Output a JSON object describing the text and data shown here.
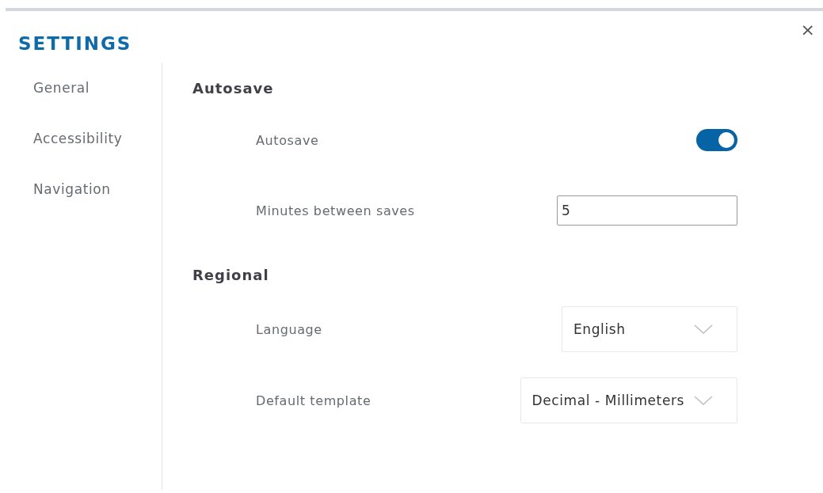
{
  "dialog": {
    "title": "SETTINGS",
    "close": "×"
  },
  "sidebar": {
    "items": [
      {
        "label": "General"
      },
      {
        "label": "Accessibility"
      },
      {
        "label": "Navigation"
      }
    ]
  },
  "sections": [
    {
      "title": "Autosave",
      "rows": [
        {
          "kind": "toggle",
          "label": "Autosave",
          "on": true
        },
        {
          "kind": "number",
          "label": "Minutes between saves",
          "value": "5"
        }
      ]
    },
    {
      "title": "Regional",
      "rows": [
        {
          "kind": "select",
          "label": "Language",
          "value": "English"
        },
        {
          "kind": "select",
          "label": "Default template",
          "value": "Decimal - Millimeters"
        }
      ]
    }
  ]
}
